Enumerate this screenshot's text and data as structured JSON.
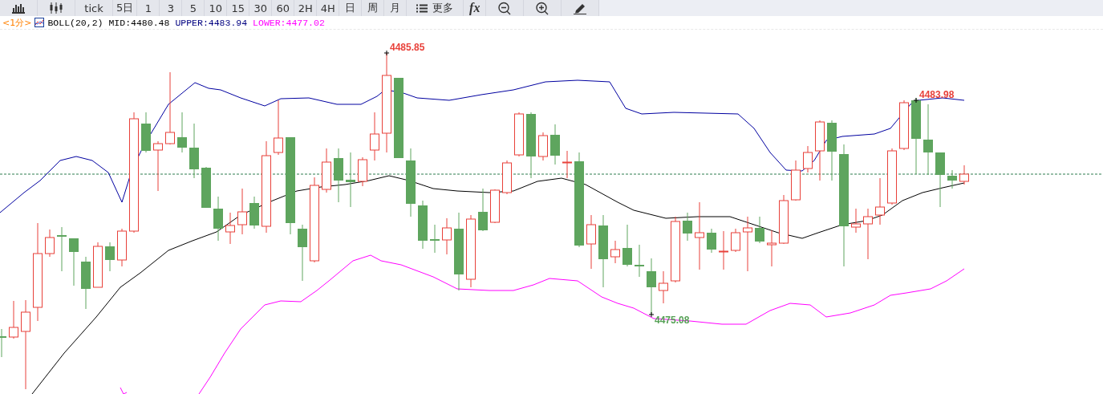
{
  "toolbar": {
    "periods": [
      "tick",
      "5日",
      "1",
      "3",
      "5",
      "10",
      "15",
      "30",
      "60",
      "2H",
      "4H",
      "日",
      "周",
      "月"
    ],
    "more": "更多",
    "formula": "fx"
  },
  "legend": {
    "period": "<1分>",
    "indicator": "BOLL(20,2)",
    "values": [
      {
        "text": "MID:4480.48",
        "color": "#000000"
      },
      {
        "text": "UPPER:4483.94",
        "color": "#000080"
      },
      {
        "text": "LOWER:4477.02",
        "color": "#ff00ff"
      }
    ]
  },
  "chart": {
    "markers": [
      {
        "text": "4485.85",
        "kind": "high"
      },
      {
        "text": "4483.98",
        "kind": "high"
      },
      {
        "text": "4475.08",
        "kind": "low"
      }
    ]
  }
}
